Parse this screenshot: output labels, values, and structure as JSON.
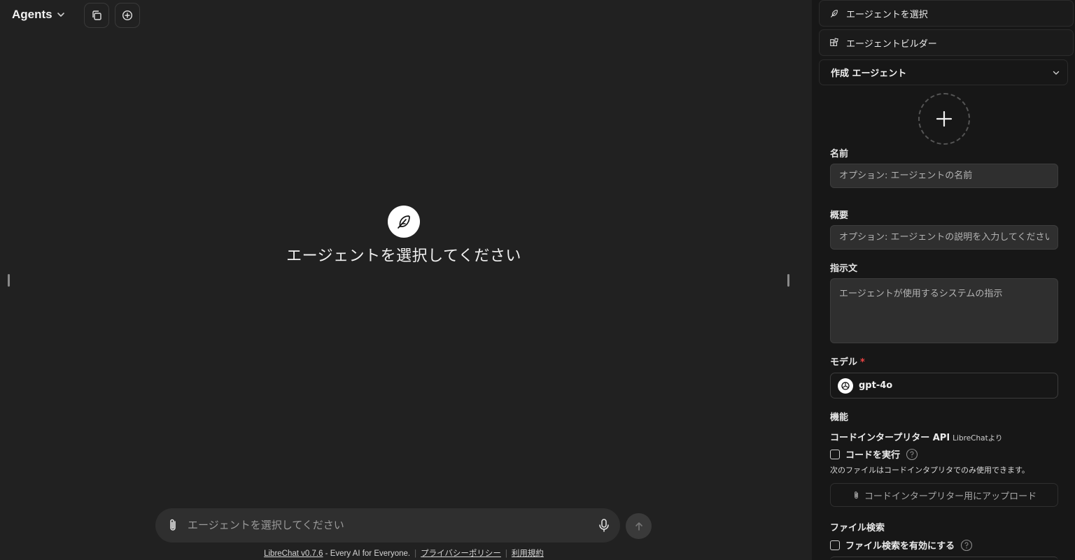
{
  "header": {
    "endpoint_label": "Agents"
  },
  "landing": {
    "title": "エージェントを選択してください"
  },
  "composer": {
    "placeholder": "エージェントを選択してください"
  },
  "footer": {
    "brand_link": "LibreChat v0.7.6",
    "tagline": " - Every AI for Everyone.",
    "privacy_link": "プライバシーポリシー",
    "terms_link": "利用規約"
  },
  "side_panel": {
    "select_agent_label": "エージェントを選択",
    "builder_label": "エージェントビルダー",
    "mode_dropdown": "作成 エージェント",
    "name": {
      "label": "名前",
      "placeholder": "オプション: エージェントの名前"
    },
    "description": {
      "label": "概要",
      "placeholder": "オプション: エージェントの説明を入力してください"
    },
    "instructions": {
      "label": "指示文",
      "placeholder": "エージェントが使用するシステムの指示"
    },
    "model": {
      "label": "モデル",
      "required_mark": "*",
      "value": "gpt-4o"
    },
    "capabilities": {
      "label": "機能",
      "code_interpreter_title": "コードインタープリター API",
      "code_interpreter_sub": "LibreChatより",
      "run_code_label": "コードを実行",
      "run_code_checked": false,
      "files_note": "次のファイルはコードインタプリタでのみ使用できます。",
      "upload_label": "コードインタープリター用にアップロード",
      "file_search_title": "ファイル検索",
      "file_search_enable_label": "ファイル検索を有効にする",
      "file_search_checked": false
    }
  },
  "colors": {
    "main_bg": "#212121",
    "side_bg": "#171717",
    "composer_bg": "#2f2f2f",
    "required": "#ef4444"
  }
}
